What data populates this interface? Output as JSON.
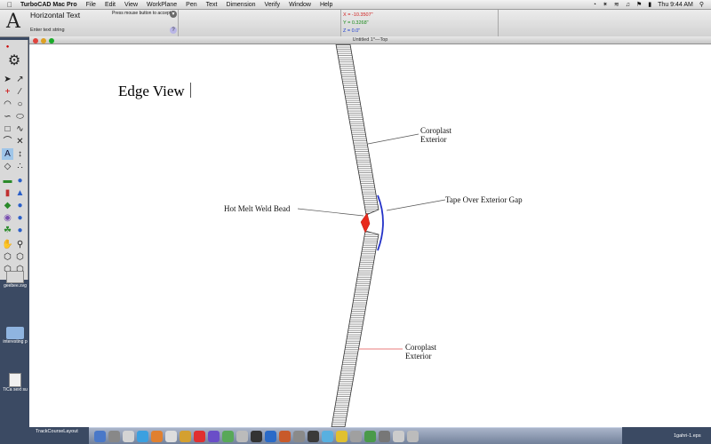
{
  "menubar": {
    "menus": [
      "TurboCAD Mac Pro",
      "File",
      "Edit",
      "View",
      "WorkPlane",
      "Pen",
      "Text",
      "Dimension",
      "Verify",
      "Window",
      "Help"
    ],
    "clock": "Thu 9:44 AM",
    "status_icons": [
      "time-machine-icon",
      "bluetooth-icon",
      "wifi-icon",
      "volume-icon",
      "flag-icon",
      "battery-icon"
    ]
  },
  "propbar": {
    "tool_name": "Horizontal Text",
    "hint": "Press mouse button to accept",
    "prompt": "Enter text string",
    "coords": {
      "x": "X = -10.3507\"",
      "y": "Y = 0.3268\"",
      "z": "Z = 0.0\""
    }
  },
  "window": {
    "title": "Untitled 1*—Top"
  },
  "drawing": {
    "heading": "Edge View",
    "labels": {
      "coroplast_top": "Coroplast\nExterior",
      "tape": "Tape Over Exterior Gap",
      "weld": "Hot Melt Weld Bead",
      "coroplast_bottom": "Coroplast\nExterior"
    },
    "colors": {
      "weld": "#e8291c",
      "tape": "#2432c8",
      "leader_bottom": "#e05050"
    }
  },
  "desktop": {
    "icons": [
      "geebee.svg",
      "interesting p",
      "TiCa sext su"
    ],
    "bottom_left_file": "TrackCourseLayout",
    "bottom_right_file": "1gahri-1.eps"
  }
}
